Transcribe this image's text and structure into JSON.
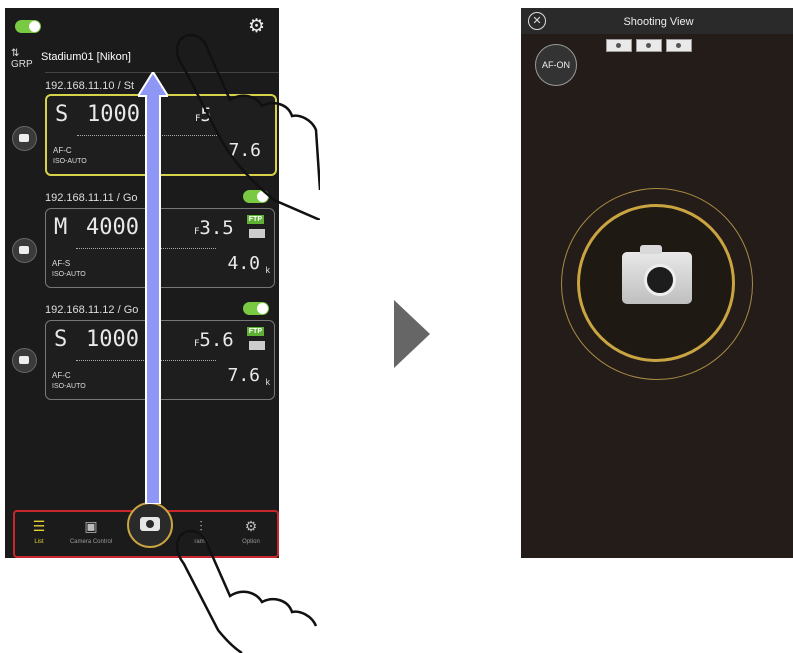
{
  "left_screen": {
    "stadium_name": "Stadium01 [Nikon]",
    "network_icon_label": "GRP",
    "cameras": [
      {
        "ip": "192.168.11.10 / St",
        "mode": "S",
        "shutter": "1000",
        "fnum": "5",
        "af": "AF-C",
        "iso": "ISO-AUTO",
        "count": "7.6"
      },
      {
        "ip": "192.168.11.11 / Go",
        "mode": "M",
        "shutter": "4000",
        "fnum": "3.5",
        "af": "AF-S",
        "iso": "ISO-AUTO",
        "count": "4.0"
      },
      {
        "ip": "192.168.11.12 / Go",
        "mode": "S",
        "shutter": "1000",
        "fnum": "5.6",
        "af": "AF-C",
        "iso": "ISO-AUTO",
        "count": "7.6"
      }
    ],
    "tabs": [
      "List",
      "Camera Control",
      "",
      "rams",
      "Option"
    ],
    "ftp_label": "FTP",
    "wb_label": "WB",
    "count_unit": "k",
    "fnum_prefix": "F"
  },
  "right_screen": {
    "title": "Shooting View",
    "af_button": "AF-ON"
  },
  "colors": {
    "accent_green": "#7ac943",
    "gold": "#c9a441",
    "tabbar_border": "#c8282b",
    "arrow_blue": "#7f86f2"
  },
  "icons": [
    "toggle-icon",
    "gear-icon",
    "network-icon",
    "camera-icon",
    "list-icon",
    "camera-control-icon",
    "parameters-icon",
    "close-icon",
    "hand-pointer-icon"
  ]
}
